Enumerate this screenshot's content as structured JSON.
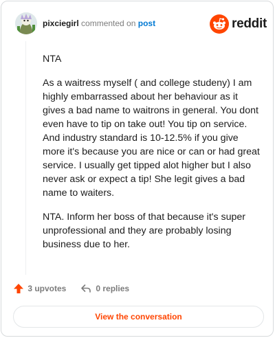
{
  "header": {
    "username": "pixciegirl",
    "action_text": "commented on",
    "post_link": "post",
    "logo_text": "reddit"
  },
  "comment": {
    "paragraphs": [
      "NTA",
      "As a waitress myself ( and college studeny) I am highly embarrassed about her behaviour as it gives a bad name to waitrons in general. You dont even have to tip on take out! You tip on service. And industry standard is 10-12.5% if you give more it's because you are nice or can or had great service. I usually get tipped alot higher but I also never ask or expect a tip! She legit gives a bad name to waiters.",
      "NTA. Inform her boss of that because it's super unprofessional and they are probably losing business due to her."
    ]
  },
  "footer": {
    "upvotes": "3 upvotes",
    "replies": "0 replies",
    "view_button": "View the conversation"
  },
  "colors": {
    "accent": "#ff4500",
    "link": "#0079d3",
    "muted": "#7c7c7c"
  },
  "icons": {
    "upvote": "upvote-arrow-icon",
    "reply": "reply-arrow-icon",
    "logo": "reddit-snoo-icon"
  }
}
